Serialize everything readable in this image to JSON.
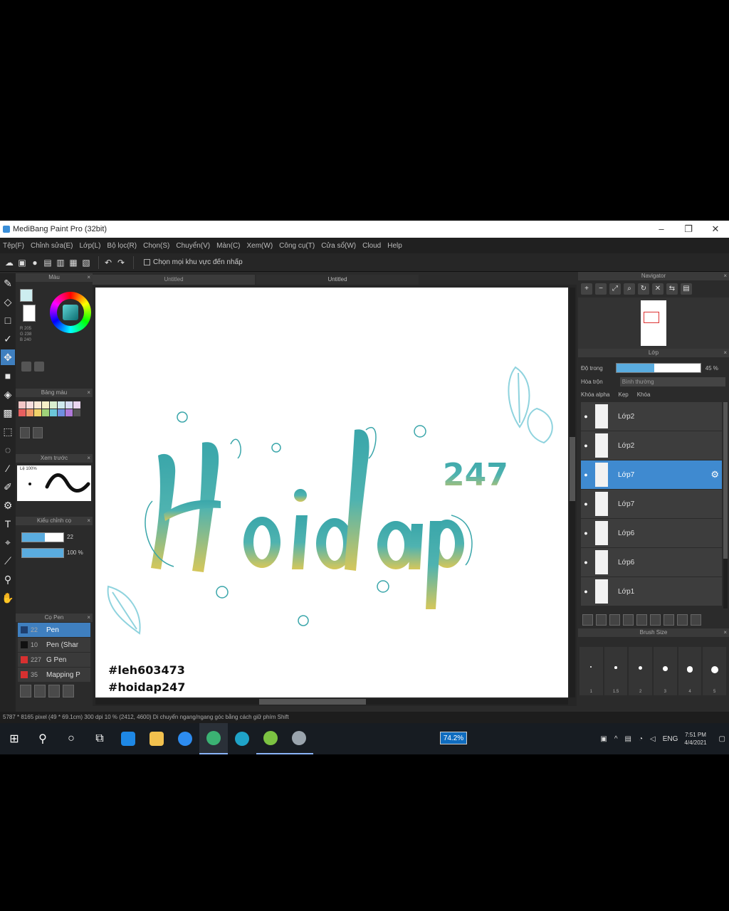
{
  "window": {
    "title": "MediBang Paint Pro (32bit)",
    "minimize": "–",
    "maximize": "❐",
    "close": "✕"
  },
  "menu": [
    "Tệp(F)",
    "Chỉnh sửa(E)",
    "Lớp(L)",
    "Bộ lọc(R)",
    "Chọn(S)",
    "Chuyển(V)",
    "Màn(C)",
    "Xem(W)",
    "Công cụ(T)",
    "Cửa sổ(W)",
    "Cloud",
    "Help"
  ],
  "toolbar": {
    "checkbox_label": "Chọn mọi khu vực đến nhấp"
  },
  "tabs": [
    "Untitled",
    "Untitled"
  ],
  "panels": {
    "color": "Màu",
    "palette": "Bảng màu",
    "brush_preview": "Xem trước",
    "brush_settings": "Kiểu chỉnh cọ",
    "brush_list": "Cọ Pen",
    "navigator": "Navigator",
    "layer": "Lớp",
    "brush_size": "Brush Size"
  },
  "color_values": [
    "R 205",
    "G 238",
    "B 240"
  ],
  "colors": {
    "foreground": "#cdeef0",
    "accent": "#3f8ad0",
    "teal": "#3aa6aa",
    "gold": "#d6c75a",
    "leaf": "#8fd3de"
  },
  "palette_swatches": [
    "#f2c6c6",
    "#f6dede",
    "#fbe9d6",
    "#f6f0c8",
    "#d9efd0",
    "#cfe9ee",
    "#d7dcf3",
    "#e9d5ef",
    "#e85f5f",
    "#f09a6a",
    "#f1d26a",
    "#9fd37a",
    "#6cc6d9",
    "#6f8fe0",
    "#b07ad9",
    "#555555"
  ],
  "brush_preview_label": "Lệ 100%",
  "brush_settings": {
    "size_value": "22",
    "size_fraction": 0.55,
    "opacity_value": "100 %",
    "opacity_fraction": 1.0
  },
  "brushes": [
    {
      "size": "22",
      "name": "Pen",
      "color": "#1f3f6f",
      "selected": true
    },
    {
      "size": "10",
      "name": "Pen (Shar",
      "color": "#111111",
      "selected": false
    },
    {
      "size": "227",
      "name": "G Pen",
      "color": "#d83030",
      "selected": false
    },
    {
      "size": "35",
      "name": "Mapping P",
      "color": "#d83030",
      "selected": false
    }
  ],
  "canvas": {
    "lettering": "Hoidap",
    "superscript": "247",
    "tag1": "#leh603473",
    "tag2": "#hoidap247"
  },
  "layer_props": {
    "opacity_label": "Độ trong",
    "opacity_value": "45 %",
    "opacity_fraction": 0.45,
    "blend_label": "Hòa trộn",
    "blend_value": "Bình thường",
    "checks": [
      "Khóa alpha",
      "Kẹp",
      "Khóa"
    ]
  },
  "layers": [
    {
      "name": "Lớp2",
      "selected": false
    },
    {
      "name": "Lớp2",
      "selected": false
    },
    {
      "name": "Lớp7",
      "selected": true
    },
    {
      "name": "Lớp7",
      "selected": false
    },
    {
      "name": "Lớp6",
      "selected": false
    },
    {
      "name": "Lớp6",
      "selected": false
    },
    {
      "name": "Lớp1",
      "selected": false
    }
  ],
  "brush_sizes": [
    "1",
    "1.5",
    "2",
    "3",
    "4",
    "5"
  ],
  "status": "5787 * 8165 pixel  (49 * 69.1cm)  300 dpi  10 %  (2412, 4600)  Di chuyển ngang/ngang góc bằng cách giữ phím Shift",
  "taskbar": {
    "battery": "74.2%",
    "lang": "ENG",
    "time": "7:51 PM",
    "date": "4/4/2021"
  }
}
